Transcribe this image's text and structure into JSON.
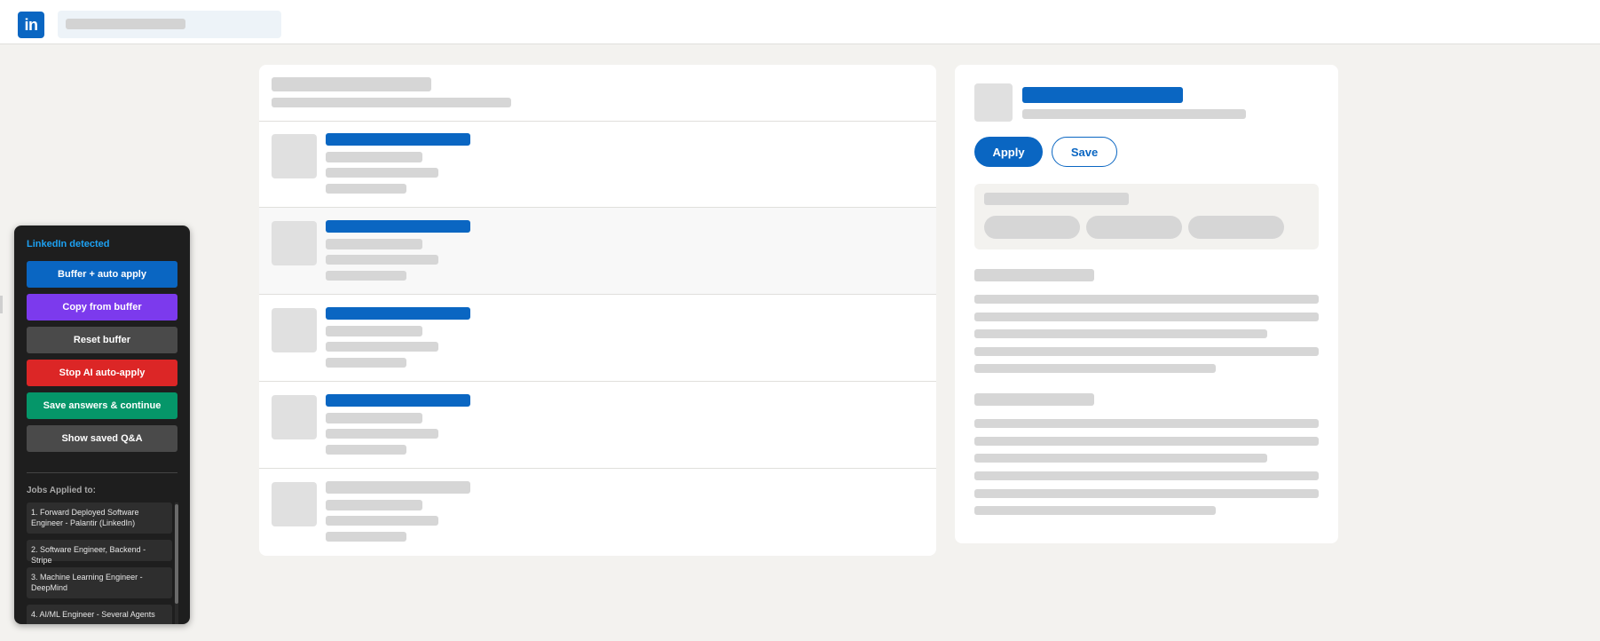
{
  "header": {
    "logo_text": "in",
    "brand_color": "#0a66c2"
  },
  "job_detail": {
    "apply_label": "Apply",
    "save_label": "Save"
  },
  "extension_panel": {
    "status": "LinkedIn detected",
    "buttons": {
      "buffer_auto_apply": "Buffer + auto apply",
      "copy_from_buffer": "Copy from buffer",
      "reset_buffer": "Reset buffer",
      "stop_ai_auto_apply": "Stop AI auto-apply",
      "save_answers_continue": "Save answers & continue",
      "show_saved_qa": "Show saved Q&A"
    },
    "button_colors": {
      "buffer_auto_apply": "#0a66c2",
      "copy_from_buffer": "#7c3aed",
      "reset_buffer": "#4a4a4a",
      "stop_ai_auto_apply": "#dc2626",
      "save_answers_continue": "#059669",
      "show_saved_qa": "#4a4a4a"
    },
    "jobs_title": "Jobs Applied to:",
    "jobs": [
      "1. Forward Deployed Software Engineer - Palantir (LinkedIn)",
      "2. Software Engineer, Backend - Stripe",
      "3. Machine Learning Engineer - DeepMind",
      "4. AI/ML Engineer - Several Agents"
    ]
  }
}
